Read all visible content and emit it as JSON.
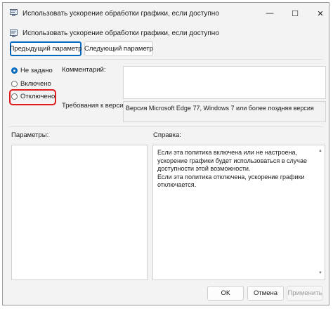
{
  "window": {
    "title": "Использовать ускорение обработки графики, если доступно",
    "minimize_glyph": "—",
    "maximize_glyph": "☐",
    "close_glyph": "✕"
  },
  "policy": {
    "title": "Использовать ускорение обработки графики, если доступно"
  },
  "nav": {
    "prev_label": "Предыдущий параметр",
    "next_label": "Следующий параметр"
  },
  "state": {
    "options": [
      {
        "label": "Не задано",
        "checked": true
      },
      {
        "label": "Включено",
        "checked": false
      },
      {
        "label": "Отключено",
        "checked": false
      }
    ]
  },
  "comment": {
    "label": "Комментарий:",
    "value": ""
  },
  "requirements": {
    "label": "Требования к версии:",
    "value": "Версия Microsoft Edge 77, Windows 7 или более поздняя версия"
  },
  "options_panel": {
    "label": "Параметры:"
  },
  "help_panel": {
    "label": "Справка:",
    "paragraphs": [
      "Если эта политика включена или не настроена, ускорение графики будет использоваться в случае доступности этой возможности.",
      "Если эта политика отключена, ускорение графики отключается."
    ]
  },
  "footer": {
    "ok_label": "ОК",
    "cancel_label": "Отмена",
    "apply_label": "Применить"
  },
  "colors": {
    "accent": "#0067c0",
    "highlight": "#e11c1c"
  }
}
